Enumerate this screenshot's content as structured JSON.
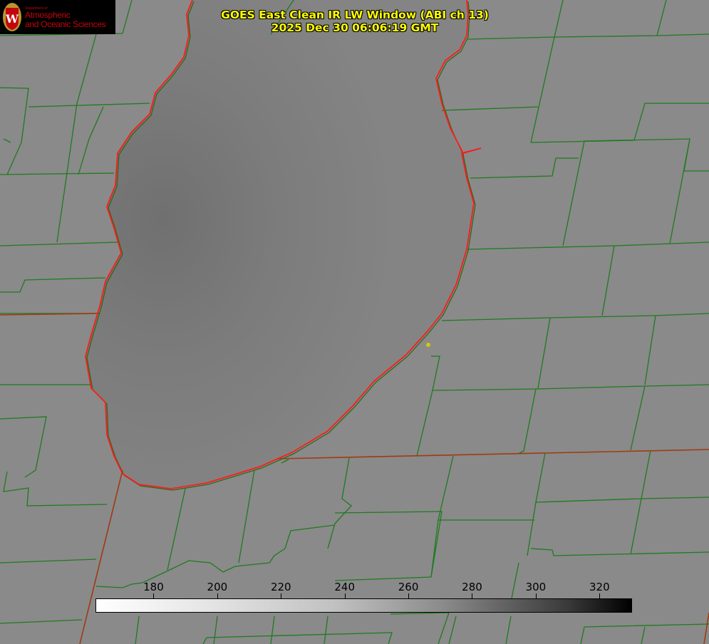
{
  "logo": {
    "department": "Department of",
    "line1": "Atmospheric",
    "line2": "and Oceanic Sciences",
    "seal_letter": "W"
  },
  "title": {
    "line1": "GOES East Clean IR LW Window (ABI ch 13)",
    "line2": "2025 Dec 30 06:06:19 GMT"
  },
  "colorbar": {
    "range": [
      162,
      330
    ],
    "ticks": [
      "180",
      "200",
      "220",
      "240",
      "260",
      "280",
      "300",
      "320"
    ],
    "tick_values": [
      180,
      200,
      220,
      240,
      260,
      280,
      300,
      320
    ],
    "low_color": "#ffffff",
    "high_color": "#000000"
  },
  "colors": {
    "background": "#8a8a8a",
    "lake": "#7f7f7f",
    "county_lines": "#1f7a1f",
    "shoreline": "#ff1a1a",
    "title": "#ffff00",
    "marker": "#d4c800"
  }
}
